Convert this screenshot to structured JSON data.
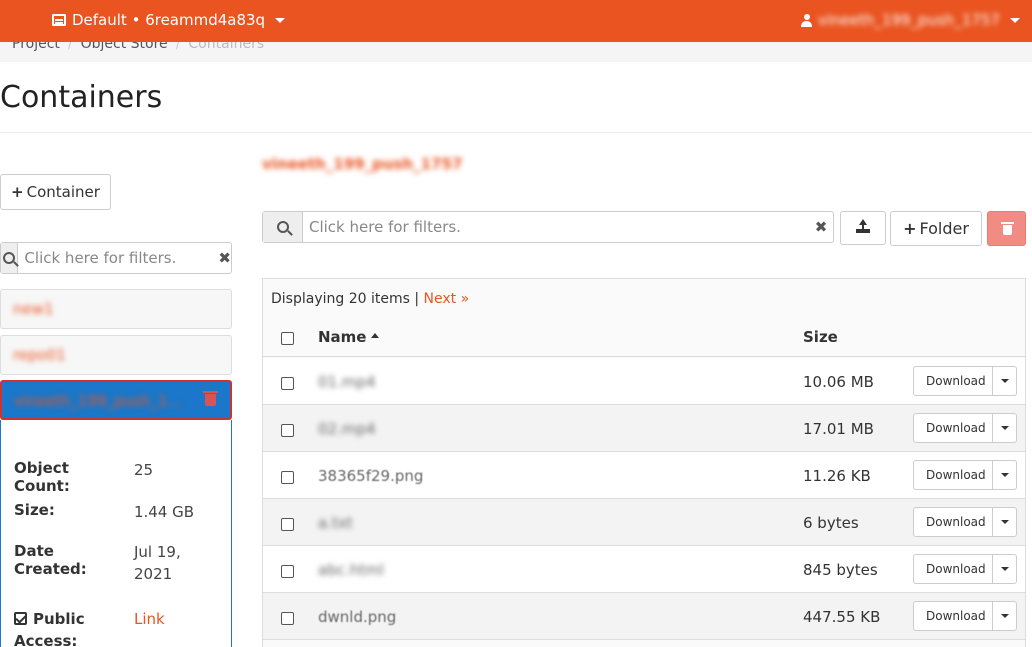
{
  "topbar": {
    "project_label": "Default • 6reammd4a83q",
    "user_label": "vineeth_199_push_1757"
  },
  "breadcrumb": [
    "Project",
    "Object Store",
    "Containers"
  ],
  "page_title": "Containers",
  "left": {
    "add_container_label": "Container",
    "search_placeholder": "Click here for filters.",
    "containers": [
      "new1",
      "repo01",
      "vineeth_199_push_1757"
    ],
    "details": {
      "object_count_label": "Object Count:",
      "object_count": "25",
      "size_label": "Size:",
      "size": "1.44 GB",
      "date_created_label": "Date Created:",
      "date_created": "Jul 19, 2021",
      "public_access_label": "Public Access:",
      "public_access_value": "Link"
    }
  },
  "right": {
    "container_title": "vineeth_199_push_1757",
    "search_placeholder": "Click here for filters.",
    "folder_button_label": "Folder",
    "displaying_text": "Displaying 20 items |",
    "next_link": "Next »",
    "columns": {
      "name": "Name",
      "size": "Size"
    },
    "download_label": "Download",
    "rows": [
      {
        "name": "01.mp4",
        "size": "10.06 MB"
      },
      {
        "name": "02.mp4",
        "size": "17.01 MB"
      },
      {
        "name": "38365f29.png",
        "size": "11.26 KB"
      },
      {
        "name": "a.txt",
        "size": "6 bytes"
      },
      {
        "name": "abc.html",
        "size": "845 bytes"
      },
      {
        "name": "dwnld.png",
        "size": "447.55 KB"
      }
    ]
  },
  "colors": {
    "brand": "#e95420",
    "selected": "#1a77c9",
    "danger": "#d9534f"
  },
  "icons": [
    "project-icon",
    "user-icon",
    "search-icon",
    "clear-icon",
    "trash-icon",
    "upload-icon",
    "plus-icon",
    "sort-asc-icon",
    "checkbox-icon",
    "chevron-down-icon"
  ]
}
